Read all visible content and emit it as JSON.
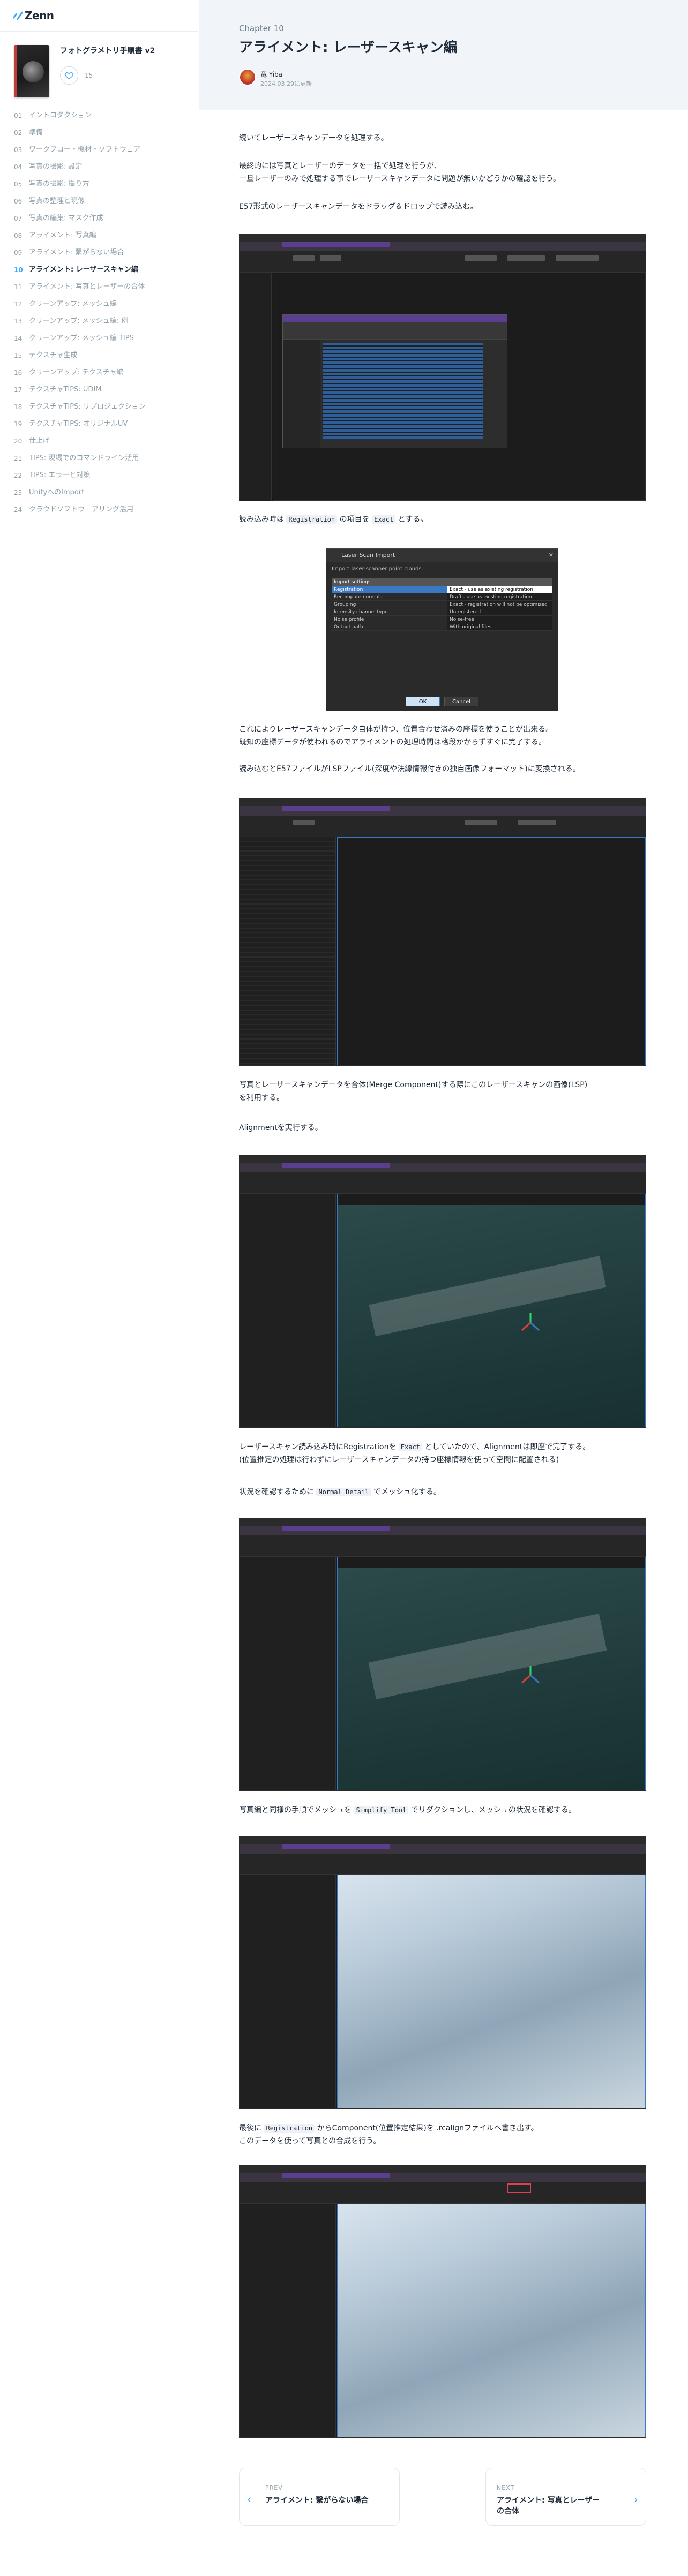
{
  "site": {
    "logo_text": "Zenn"
  },
  "book": {
    "title": "フォトグラメトリ手順書 v2",
    "likes": "15"
  },
  "toc": [
    {
      "num": "01",
      "label": "イントロダクション"
    },
    {
      "num": "02",
      "label": "準備"
    },
    {
      "num": "03",
      "label": "ワークフロー・機材・ソフトウェア"
    },
    {
      "num": "04",
      "label": "写真の撮影: 設定"
    },
    {
      "num": "05",
      "label": "写真の撮影: 撮り方"
    },
    {
      "num": "06",
      "label": "写真の整理と現像"
    },
    {
      "num": "07",
      "label": "写真の編集: マスク作成"
    },
    {
      "num": "08",
      "label": "アライメント: 写真編"
    },
    {
      "num": "09",
      "label": "アライメント: 繋がらない場合"
    },
    {
      "num": "10",
      "label": "アライメント: レーザースキャン編",
      "active": true
    },
    {
      "num": "11",
      "label": "アライメント: 写真とレーザーの合体"
    },
    {
      "num": "12",
      "label": "クリーンアップ: メッシュ編"
    },
    {
      "num": "13",
      "label": "クリーンアップ: メッシュ編: 例"
    },
    {
      "num": "14",
      "label": "クリーンアップ: メッシュ編 TIPS"
    },
    {
      "num": "15",
      "label": "テクスチャ生成"
    },
    {
      "num": "16",
      "label": "クリーンアップ: テクスチャ編"
    },
    {
      "num": "17",
      "label": "テクスチャTIPS: UDIM"
    },
    {
      "num": "18",
      "label": "テクスチャTIPS: リプロジェクション"
    },
    {
      "num": "19",
      "label": "テクスチャTIPS: オリジナルUV"
    },
    {
      "num": "20",
      "label": "仕上げ"
    },
    {
      "num": "21",
      "label": "TIPS: 現場でのコマンドライン活用"
    },
    {
      "num": "22",
      "label": "TIPS: エラーと対策"
    },
    {
      "num": "23",
      "label": "UnityへのImport"
    },
    {
      "num": "24",
      "label": "クラウドソフトウェアリング活用"
    }
  ],
  "header": {
    "chapter_label": "Chapter 10",
    "chapter_title": "アライメント: レーザースキャン編",
    "author": "竜 Yiba",
    "date": "2024.03.29に更新"
  },
  "article": {
    "p1": "続いてレーザースキャンデータを処理する。",
    "p2": "最終的には写真とレーザーのデータを一括で処理を行うが、\n一旦レーザーのみで処理する事でレーザースキャンデータに問題が無いかどうかの確認を行う。",
    "p3": "E57形式のレーザースキャンデータをドラッグ＆ドロップで読み込む。",
    "p4_a": "読み込み時は ",
    "p4_code1": "Registration",
    "p4_b": " の項目を ",
    "p4_code2": "Exact",
    "p4_c": " とする。",
    "p5": "これによりレーザースキャンデータ自体が持つ、位置合わせ済みの座標を使うことが出来る。\n既知の座標データが使われるのでアライメントの処理時間は格段かからずすぐに完了する。",
    "p6": "読み込むとE57ファイルがLSPファイル(深度や法線情報付きの独自画像フォーマット)に変換される。",
    "p7": "写真とレーザースキャンデータを合体(Merge Component)する際にこのレーザースキャンの画像(LSP)\nを利用する。",
    "p8": "Alignmentを実行する。",
    "p9_a": "レーザースキャン読み込み時にRegistrationを ",
    "p9_code": "Exact",
    "p9_b": " としていたので、Alignmentは即座で完了する。\n(位置推定の処理は行わずにレーザースキャンデータの持つ座標情報を使って空間に配置される)",
    "p10_a": "状況を確認するために ",
    "p10_code": "Normal Detail",
    "p10_b": " でメッシュ化する。",
    "p11_a": "写真編と同様の手順でメッシュを ",
    "p11_code": "Simplify Tool",
    "p11_b": " でリダクションし、メッシュの状況を確認する。",
    "p12_a": "最後に ",
    "p12_code": "Registration",
    "p12_b": " からComponent(位置推定結果)を .rcalignファイルへ書き出す。\nこのデータを使って写真との合成を行う。"
  },
  "dialog": {
    "title": "Laser Scan Import",
    "subtitle": "Import laser-scanner point clouds.",
    "section": "Import settings",
    "rows": [
      {
        "k": "Registration",
        "v": "Exact - use as existing registration",
        "hl": true
      },
      {
        "k": "Recompute normals",
        "v": "Draft - use as existing registration"
      },
      {
        "k": "Grouping",
        "v": "Exact - registration will not be optimized"
      },
      {
        "k": "Intensity channel type",
        "v": "Unregistered"
      },
      {
        "k": "Noise profile",
        "v": "Noise-free"
      },
      {
        "k": "Output path",
        "v": "With original files"
      }
    ],
    "ok": "OK",
    "cancel": "Cancel"
  },
  "pager": {
    "prev_label": "PREV",
    "prev_title": "アライメント: 繋がらない場合",
    "next_label": "NEXT",
    "next_title": "アライメント: 写真とレーザー\nの合体"
  }
}
